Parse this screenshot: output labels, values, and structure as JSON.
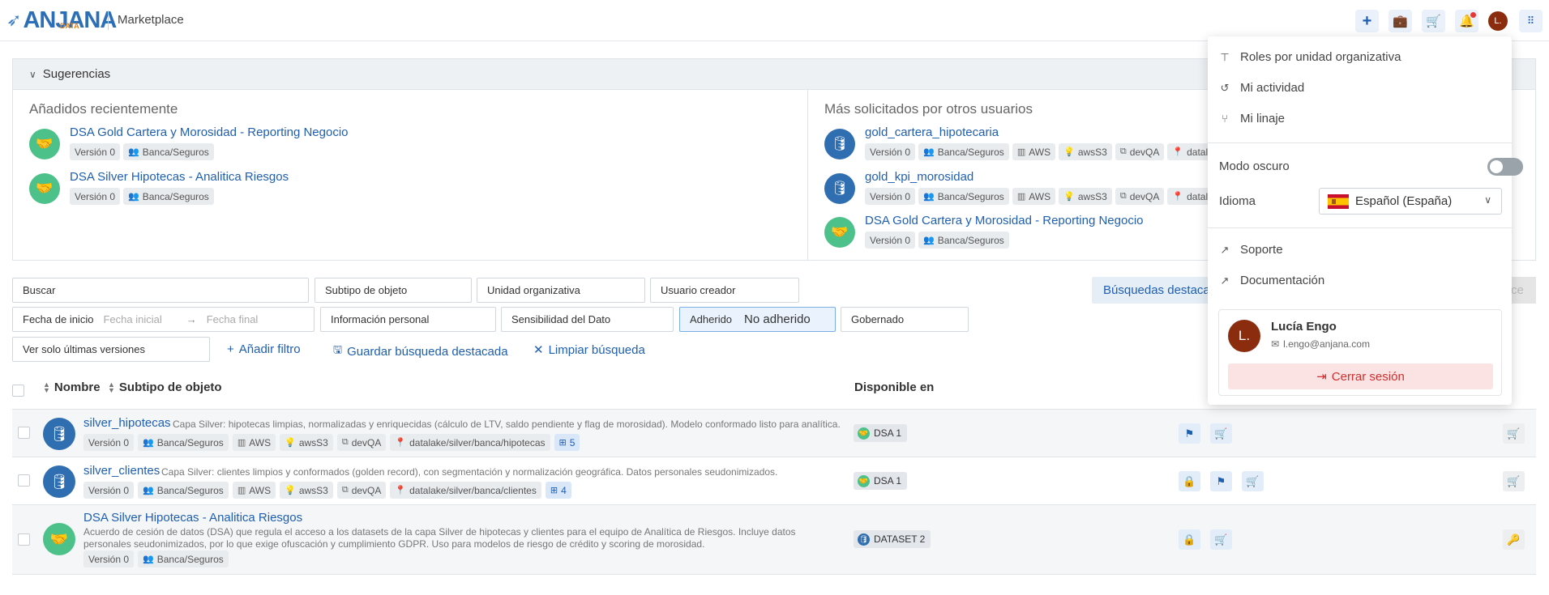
{
  "header": {
    "logo_main": "ANJANA",
    "logo_sub": "DATA",
    "app_title": "Marketplace",
    "avatar_initials": "L."
  },
  "suggestions": {
    "title": "Sugerencias",
    "recent": {
      "heading": "Añadidos recientemente",
      "items": [
        {
          "name": "DSA Gold Cartera y Morosidad - Reporting Negocio",
          "tags": [
            "Versión 0",
            "Banca/Seguros"
          ]
        },
        {
          "name": "DSA Silver Hipotecas - Analitica Riesgos",
          "tags": [
            "Versión 0",
            "Banca/Seguros"
          ]
        }
      ]
    },
    "popular": {
      "heading": "Más solicitados por otros usuarios",
      "items": [
        {
          "name": "gold_cartera_hipotecaria",
          "tags": [
            "Versión 0",
            "Banca/Seguros",
            "AWS",
            "awsS3",
            "devQA",
            "datalake"
          ]
        },
        {
          "name": "gold_kpi_morosidad",
          "tags": [
            "Versión 0",
            "Banca/Seguros",
            "AWS",
            "awsS3",
            "devQA",
            "datalake"
          ]
        },
        {
          "name": "DSA Gold Cartera y Morosidad - Reporting Negocio",
          "tags": [
            "Versión 0",
            "Banca/Seguros"
          ]
        }
      ]
    }
  },
  "filters": {
    "buscar": "Buscar",
    "subtipo": "Subtipo de objeto",
    "unidad": "Unidad organizativa",
    "usuario": "Usuario creador",
    "fecha_label": "Fecha de inicio",
    "fecha_inicial": "Fecha inicial",
    "fecha_final": "Fecha final",
    "info_personal": "Información personal",
    "sensibilidad": "Sensibilidad del Dato",
    "adherido_label": "Adherido",
    "adherido_value": "No adherido",
    "gobernado": "Gobernado",
    "ultimas": "Ver solo últimas versiones",
    "add_filter": "Añadir filtro",
    "save_search": "Guardar búsqueda destacada",
    "clear_search": "Limpiar búsqueda",
    "featured": "Búsquedas destaca",
    "ce": "ce"
  },
  "table": {
    "headers": {
      "nombre": "Nombre",
      "subtipo": "Subtipo de objeto",
      "disponible": "Disponible en"
    },
    "rows": [
      {
        "name": "silver_hipotecas",
        "desc": "Capa Silver: hipotecas limpias, normalizadas y enriquecidas (cálculo de LTV, saldo pendiente y flag de morosidad). Modelo conformado listo para analítica.",
        "tags": [
          "Versión 0",
          "Banca/Seguros",
          "AWS",
          "awsS3",
          "devQA",
          "datalake/silver/banca/hipotecas"
        ],
        "count": "5",
        "available": "DSA 1"
      },
      {
        "name": "silver_clientes",
        "desc": "Capa Silver: clientes limpios y conformados (golden record), con segmentación y normalización geográfica. Datos personales seudonimizados.",
        "tags": [
          "Versión 0",
          "Banca/Seguros",
          "AWS",
          "awsS3",
          "devQA",
          "datalake/silver/banca/clientes"
        ],
        "count": "4",
        "available": "DSA 1"
      },
      {
        "name": "DSA Silver Hipotecas - Analitica Riesgos",
        "desc": "Acuerdo de cesión de datos (DSA) que regula el acceso a los datasets de la capa Silver de hipotecas y clientes para el equipo de Analítica de Riesgos. Incluye datos personales seudonimizados, por lo que exige ofuscación y cumplimiento GDPR. Uso para modelos de riesgo de crédito y scoring de morosidad.",
        "tags": [
          "Versión 0",
          "Banca/Seguros"
        ],
        "available": "DATASET 2"
      }
    ]
  },
  "menu": {
    "roles": "Roles por unidad organizativa",
    "actividad": "Mi actividad",
    "linaje": "Mi linaje",
    "modo_oscuro": "Modo oscuro",
    "idioma": "Idioma",
    "idioma_value": "Español (España)",
    "soporte": "Soporte",
    "documentacion": "Documentación",
    "user_name": "Lucía Engo",
    "user_email": "l.engo@anjana.com",
    "user_initials": "L.",
    "logout": "Cerrar sesión"
  }
}
